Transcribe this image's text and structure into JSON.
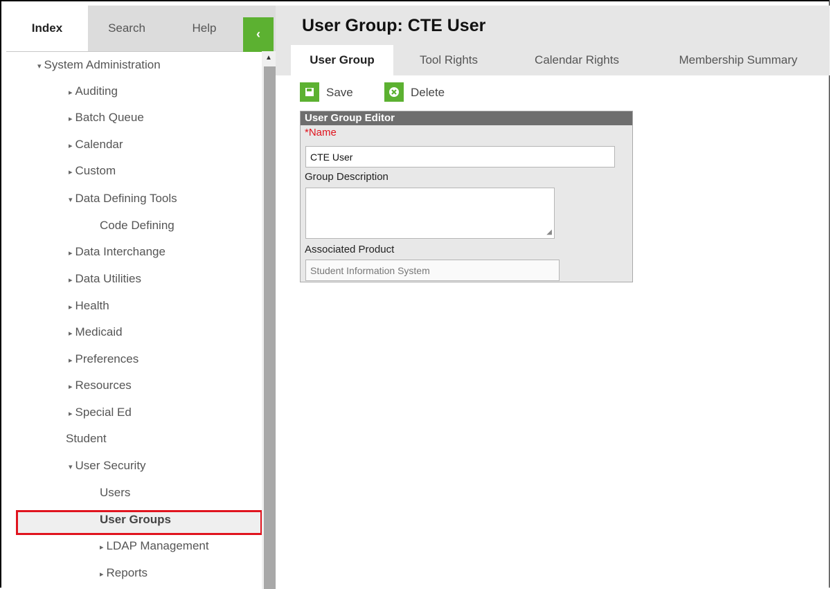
{
  "left_tabs": {
    "index": "Index",
    "search": "Search",
    "help": "Help",
    "collapse_glyph": "‹"
  },
  "tree": [
    {
      "label": "System Administration",
      "marker": "▾"
    },
    {
      "label": "Auditing",
      "marker": "▸"
    },
    {
      "label": "Batch Queue",
      "marker": "▸"
    },
    {
      "label": "Calendar",
      "marker": "▸"
    },
    {
      "label": "Custom",
      "marker": "▸"
    },
    {
      "label": "Data Defining Tools",
      "marker": "▾"
    },
    {
      "label": "Code Defining",
      "marker": ""
    },
    {
      "label": "Data Interchange",
      "marker": "▸"
    },
    {
      "label": "Data Utilities",
      "marker": "▸"
    },
    {
      "label": "Health",
      "marker": "▸"
    },
    {
      "label": "Medicaid",
      "marker": "▸"
    },
    {
      "label": "Preferences",
      "marker": "▸"
    },
    {
      "label": "Resources",
      "marker": "▸"
    },
    {
      "label": "Special Ed",
      "marker": "▸"
    },
    {
      "label": "Student",
      "marker": ""
    },
    {
      "label": "User Security",
      "marker": "▾"
    },
    {
      "label": "Users",
      "marker": ""
    },
    {
      "label": "User Groups",
      "marker": ""
    },
    {
      "label": "LDAP Management",
      "marker": "▸"
    },
    {
      "label": "Reports",
      "marker": "▸"
    }
  ],
  "page_title": "User Group: CTE User",
  "sub_tabs": [
    "User Group",
    "Tool Rights",
    "Calendar Rights",
    "Membership Summary"
  ],
  "toolbar": {
    "save_label": "Save",
    "delete_label": "Delete"
  },
  "editor": {
    "header": "User Group Editor",
    "name_label": "*Name",
    "name_value": "CTE User",
    "description_label": "Group Description",
    "description_value": "",
    "product_label": "Associated Product",
    "product_value": "Student Information System"
  },
  "colors": {
    "accent_green": "#5cb131",
    "highlight_red": "#e0141e",
    "editor_header": "#6e6e6e"
  },
  "icons": {
    "save": "save-icon",
    "delete": "delete-icon",
    "collapse": "chevron-left-icon"
  }
}
